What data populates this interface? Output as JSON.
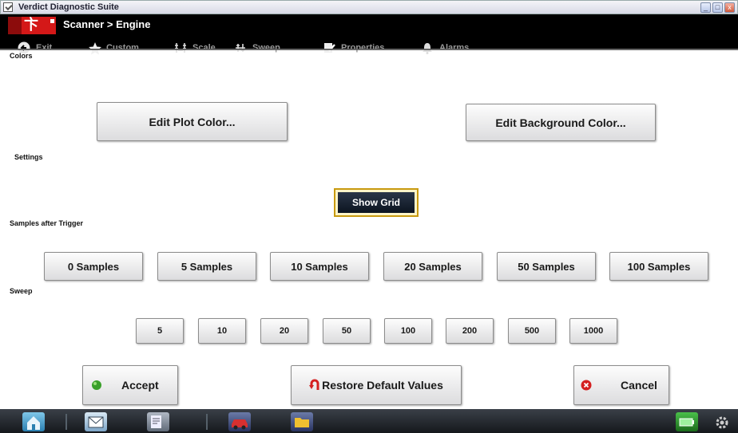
{
  "window": {
    "title": "Verdict Diagnostic Suite",
    "controls": {
      "minimize": "_",
      "maximize": "□",
      "close": "x"
    }
  },
  "header": {
    "breadcrumb": "Scanner  > Engine",
    "logo_icon": "snap-on-logo-icon"
  },
  "toolbar": {
    "items": [
      {
        "label": "Exit",
        "icon": "back-arrow-icon"
      },
      {
        "label": "Custom",
        "icon": "star-icon"
      },
      {
        "label": "Scale",
        "icon": "scale-icon"
      },
      {
        "label": "Sweep",
        "icon": "sweep-icon"
      },
      {
        "label": "Properties",
        "icon": "properties-icon"
      },
      {
        "label": "Alarms",
        "icon": "bell-icon"
      }
    ]
  },
  "sections": {
    "colors": "Colors",
    "settings": "Settings",
    "samples": "Samples after Trigger",
    "sweep": "Sweep"
  },
  "colors": {
    "edit_plot": "Edit Plot Color...",
    "edit_background": "Edit Background Color..."
  },
  "settings": {
    "show_grid": "Show Grid"
  },
  "samples": [
    "0 Samples",
    "5 Samples",
    "10 Samples",
    "20 Samples",
    "50 Samples",
    "100 Samples"
  ],
  "sweep": [
    "5",
    "10",
    "20",
    "50",
    "100",
    "200",
    "500",
    "1000"
  ],
  "actions": {
    "accept": "Accept",
    "restore": "Restore Default Values",
    "cancel": "Cancel"
  },
  "colors_palette": {
    "accent_gold": "#c89a10",
    "accept_green": "#3aa02a",
    "cancel_red": "#d42020",
    "header_bg": "#000000"
  },
  "taskbar": {
    "icons": [
      "home-icon",
      "envelope-icon",
      "notepad-icon",
      "car-icon",
      "folder-icon",
      "battery-icon",
      "settings-icon"
    ]
  }
}
